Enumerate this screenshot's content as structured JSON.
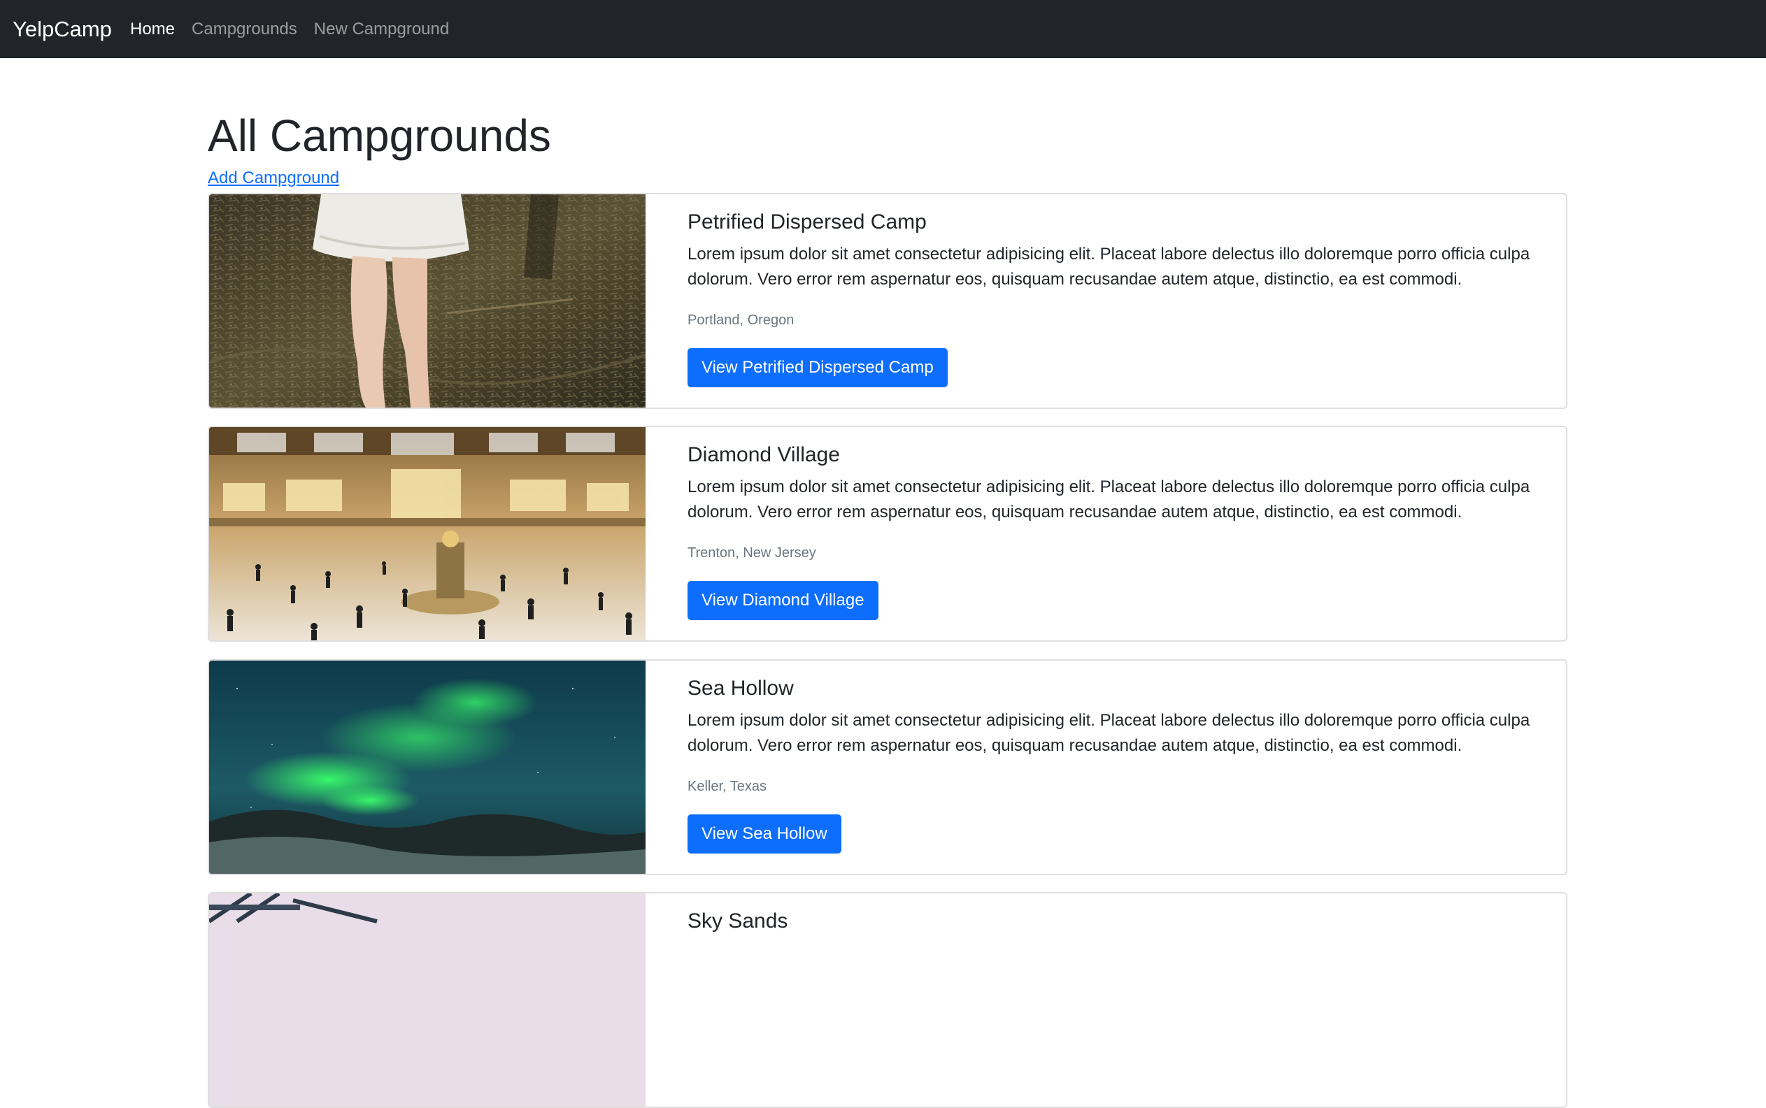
{
  "navbar": {
    "brand": "YelpCamp",
    "links": [
      {
        "label": "Home",
        "active": true
      },
      {
        "label": "Campgrounds",
        "active": false
      },
      {
        "label": "New Campground",
        "active": false
      }
    ]
  },
  "main": {
    "title": "All Campgrounds",
    "add_link": "Add Campground"
  },
  "campgrounds": [
    {
      "title": "Petrified Dispersed Camp",
      "description": "Lorem ipsum dolor sit amet consectetur adipisicing elit. Placeat labore delectus illo doloremque porro officia culpa dolorum. Vero error rem aspernatur eos, quisquam recusandae autem atque, distinctio, ea est commodi.",
      "location": "Portland, Oregon",
      "button": "View Petrified Dispersed Camp",
      "image": "person-standing-in-forest-photo"
    },
    {
      "title": "Diamond Village",
      "description": "Lorem ipsum dolor sit amet consectetur adipisicing elit. Placeat labore delectus illo doloremque porro officia culpa dolorum. Vero error rem aspernatur eos, quisquam recusandae autem atque, distinctio, ea est commodi.",
      "location": "Trenton, New Jersey",
      "button": "View Diamond Village",
      "image": "grand-central-terminal-crowd-photo"
    },
    {
      "title": "Sea Hollow",
      "description": "Lorem ipsum dolor sit amet consectetur adipisicing elit. Placeat labore delectus illo doloremque porro officia culpa dolorum. Vero error rem aspernatur eos, quisquam recusandae autem atque, distinctio, ea est commodi.",
      "location": "Keller, Texas",
      "button": "View Sea Hollow",
      "image": "aurora-borealis-photo"
    },
    {
      "title": "Sky Sands",
      "image": "bridge-pastel-sky-photo"
    }
  ],
  "colors": {
    "navbar_bg": "#212529",
    "primary": "#0d6efd",
    "muted_text": "#6c757d",
    "card_border": "#dfdfdf"
  }
}
